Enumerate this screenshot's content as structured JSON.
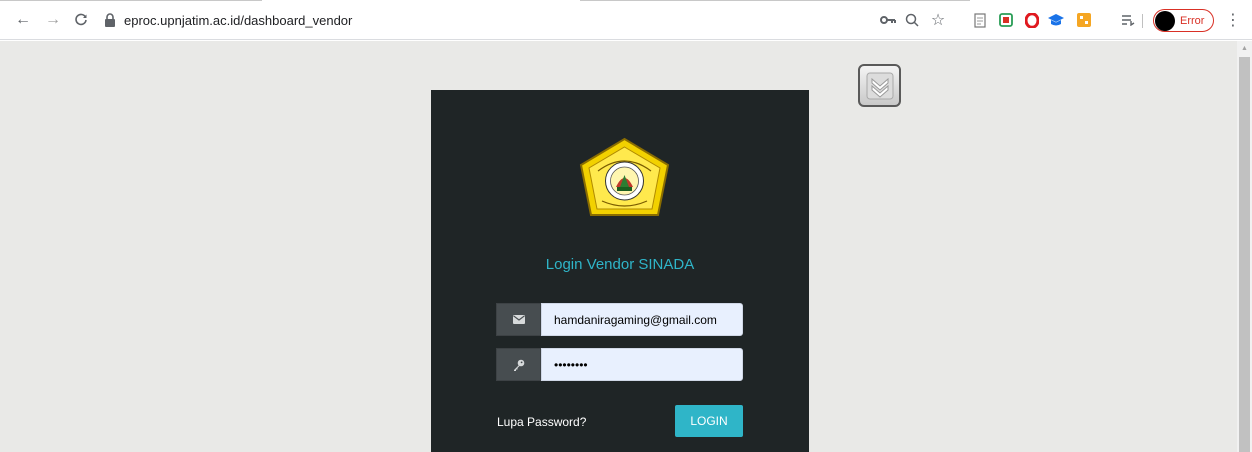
{
  "browser": {
    "url": "eproc.upnjatim.ac.id/dashboard_vendor",
    "profile_status": "Error"
  },
  "login": {
    "title": "Login Vendor SINADA",
    "email_value": "hamdaniragaming@gmail.com",
    "password_value": "••••••••",
    "forgot_label": "Lupa Password?",
    "login_label": "LOGIN"
  },
  "colors": {
    "accent": "#2fb5c8",
    "panel_bg": "#1f2526",
    "page_bg": "#e9e9e7",
    "input_bg": "#e8f0fe",
    "error": "#d93025"
  },
  "icons": {
    "email_field": "envelope-icon",
    "password_field": "key-icon"
  }
}
